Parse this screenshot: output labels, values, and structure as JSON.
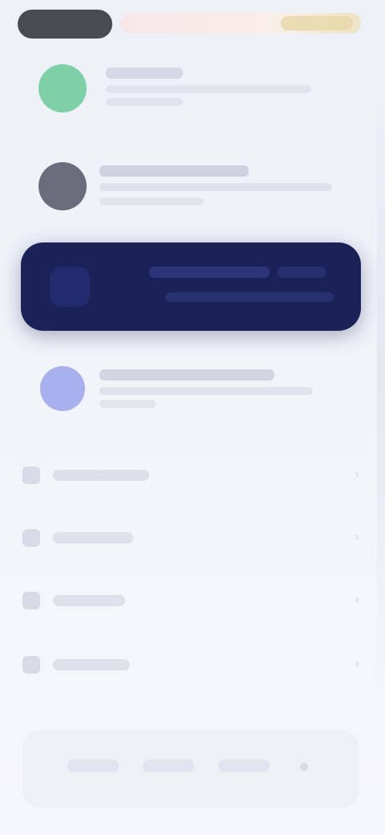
{
  "status": {
    "time": ""
  },
  "notifications": [
    {
      "title": "",
      "subtitle": ""
    },
    {
      "title": "",
      "subtitle": ""
    },
    {
      "title": "",
      "subtitle": ""
    }
  ],
  "highlight": {
    "title": ""
  },
  "menu": [
    {
      "label": ""
    },
    {
      "label": ""
    },
    {
      "label": ""
    },
    {
      "label": ""
    }
  ],
  "colors": {
    "background": "#f1f3fa",
    "highlight": "#1b2257",
    "avatar_green": "#7ed0a7",
    "avatar_gray": "#6b6c7c",
    "avatar_blue": "#a8b0ee"
  }
}
